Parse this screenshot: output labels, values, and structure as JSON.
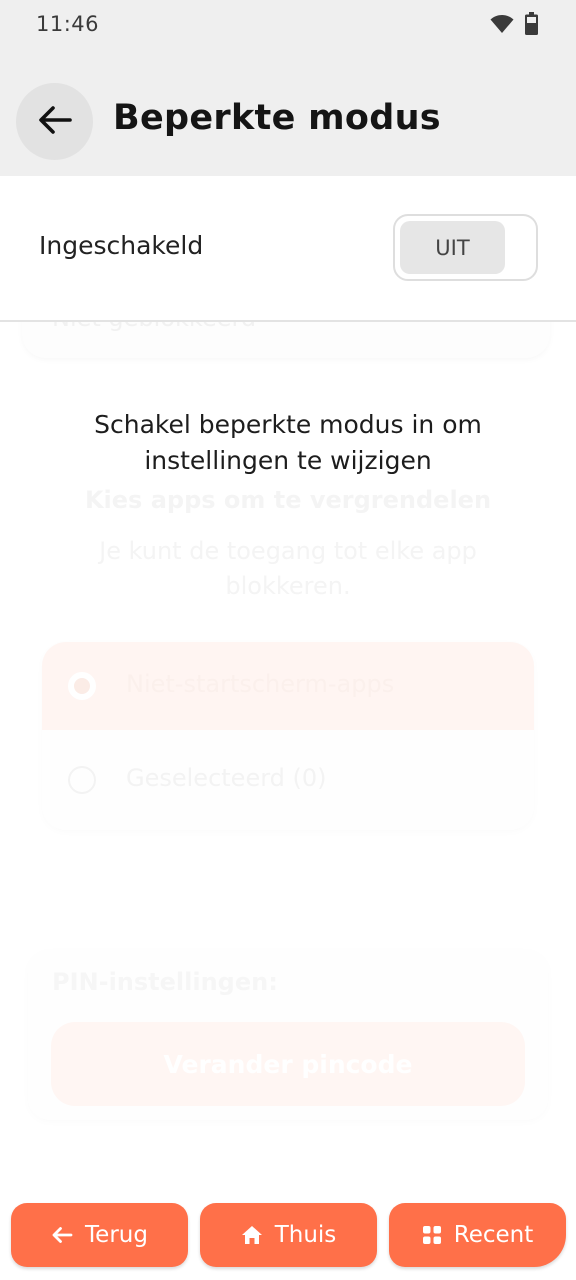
{
  "status_bar": {
    "time": "11:46"
  },
  "header": {
    "title": "Beperkte modus"
  },
  "toggle": {
    "label": "Ingeschakeld",
    "state": "UIT"
  },
  "overlay": {
    "message": "Schakel beperkte modus in om instellingen te wijzigen"
  },
  "disabled_content": {
    "top_card_text": "Niet geblokkeerd",
    "heading": "Kies apps om te vergrendelen",
    "description": "Je kunt de toegang tot elke app blokkeren.",
    "options": [
      {
        "label": "Niet-startscherm-apps",
        "selected": true
      },
      {
        "label": "Geselecteerd (0)",
        "selected": false
      }
    ],
    "pin_label": "PIN-instellingen:",
    "pin_button": "Verander pincode"
  },
  "bottom_nav": {
    "back": {
      "label": "Terug",
      "icon": "arrow-left-icon"
    },
    "home": {
      "label": "Thuis",
      "icon": "home-icon"
    },
    "recent": {
      "label": "Recent",
      "icon": "grid-icon"
    }
  },
  "colors": {
    "accent": "#ff7049",
    "appbar": "#efefef",
    "text": "#1c1c1c"
  }
}
